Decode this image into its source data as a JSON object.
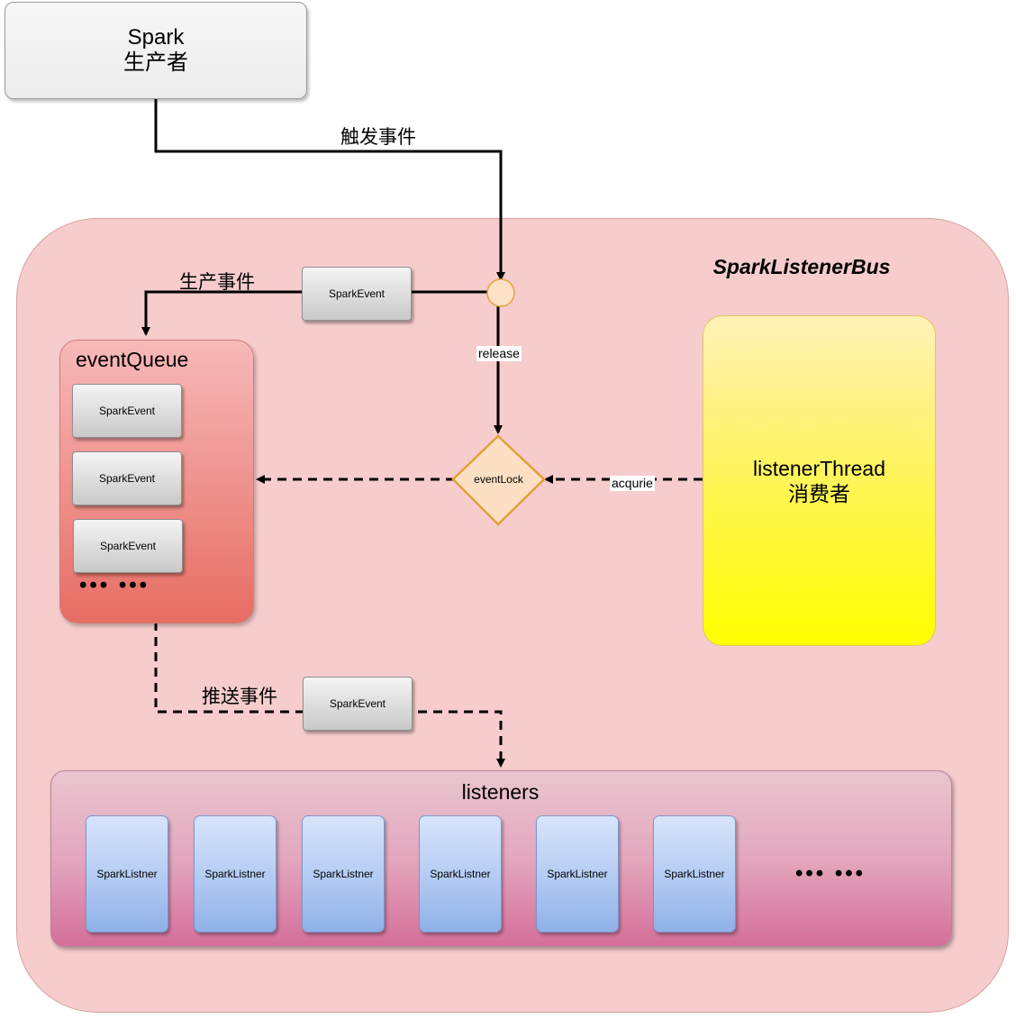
{
  "producer": {
    "line1": "Spark",
    "line2": "生产者"
  },
  "bus": {
    "title": "SparkListenerBus"
  },
  "edges": {
    "trigger": "触发事件",
    "produce": "生产事件",
    "release": "release",
    "acquire": "acqurie",
    "push": "推送事件"
  },
  "event_label": "SparkEvent",
  "lock": {
    "label": "eventLock"
  },
  "queue": {
    "title": "eventQueue",
    "items": [
      "SparkEvent",
      "SparkEvent",
      "SparkEvent"
    ],
    "more": "••• •••"
  },
  "thread": {
    "line1": "listenerThread",
    "line2": "消费者"
  },
  "listeners": {
    "title": "listeners",
    "items": [
      "SparkListner",
      "SparkListner",
      "SparkListner",
      "SparkListner",
      "SparkListner",
      "SparkListner"
    ],
    "more": "••• •••"
  }
}
